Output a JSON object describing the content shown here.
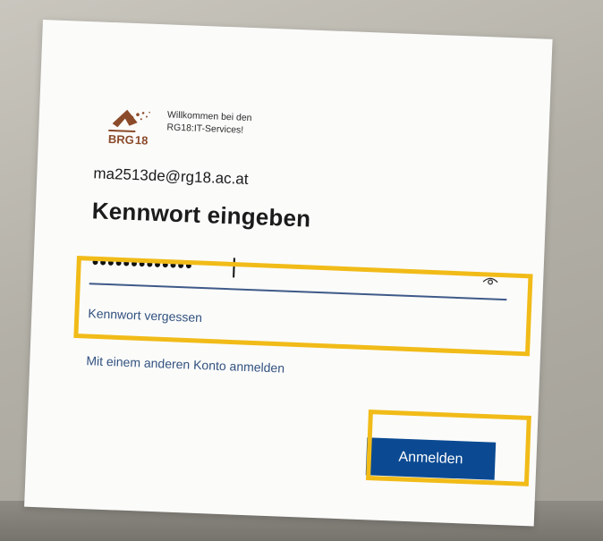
{
  "header": {
    "welcome_line_1": "Willkommen bei den",
    "welcome_line_2": "RG18:IT-Services!"
  },
  "account": {
    "email": "ma2513de@rg18.ac.at"
  },
  "form": {
    "title": "Kennwort eingeben",
    "password_masked": "•••••••••••••",
    "forgot_password_link": "Kennwort vergessen",
    "other_account_link": "Mit einem anderen Konto anmelden",
    "signin_button": "Anmelden"
  },
  "icons": {
    "logo": "brg18-logo",
    "reveal_password": "eye-icon"
  },
  "colors": {
    "primary_button": "#0b4a92",
    "link": "#31517f",
    "highlight": "#f1bb18"
  }
}
